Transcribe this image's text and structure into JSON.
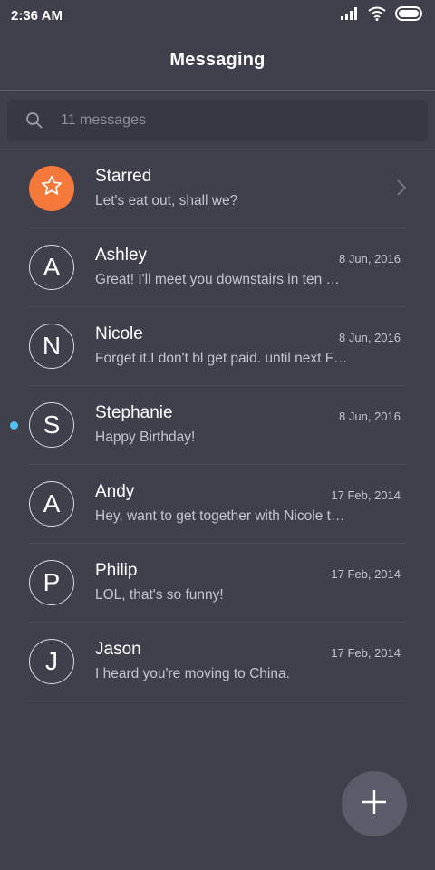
{
  "status_bar": {
    "time": "2:36 AM",
    "icons": [
      "signal-icon",
      "wifi-icon",
      "battery-icon"
    ]
  },
  "header": {
    "title": "Messaging"
  },
  "search": {
    "placeholder": "11 messages",
    "icon": "search-icon"
  },
  "conversations": [
    {
      "name": "Starred",
      "preview": "Let's eat out, shall we?",
      "date": "",
      "avatar": "",
      "avatar_icon": "star-icon",
      "avatar_color": "#f5793b",
      "unread": false
    },
    {
      "name": "Ashley",
      "preview": "Great! I'll meet you downstairs in ten minutes.",
      "date": "8 Jun, 2016",
      "avatar": "A",
      "unread": false
    },
    {
      "name": "Nicole",
      "preview": "Forget it.I don't bl get paid. until next Friday.",
      "date": "8 Jun, 2016",
      "avatar": "N",
      "unread": false
    },
    {
      "name": "Stephanie",
      "preview": "Happy Birthday!",
      "date": "8 Jun, 2016",
      "avatar": "S",
      "unread": true
    },
    {
      "name": "Andy",
      "preview": "Hey, want to get together with Nicole tonight?",
      "date": "17 Feb, 2014",
      "avatar": "A",
      "unread": false
    },
    {
      "name": "Philip",
      "preview": "LOL, that's so funny!",
      "date": "17 Feb, 2014",
      "avatar": "P",
      "unread": false
    },
    {
      "name": "Jason",
      "preview": "I heard you're moving to China.",
      "date": "17 Feb, 2014",
      "avatar": "J",
      "unread": false
    }
  ],
  "fab": {
    "icon": "plus-icon"
  },
  "colors": {
    "background": "#3f404c",
    "starred_avatar": "#f5793b",
    "unread_dot": "#4fc3f7"
  }
}
